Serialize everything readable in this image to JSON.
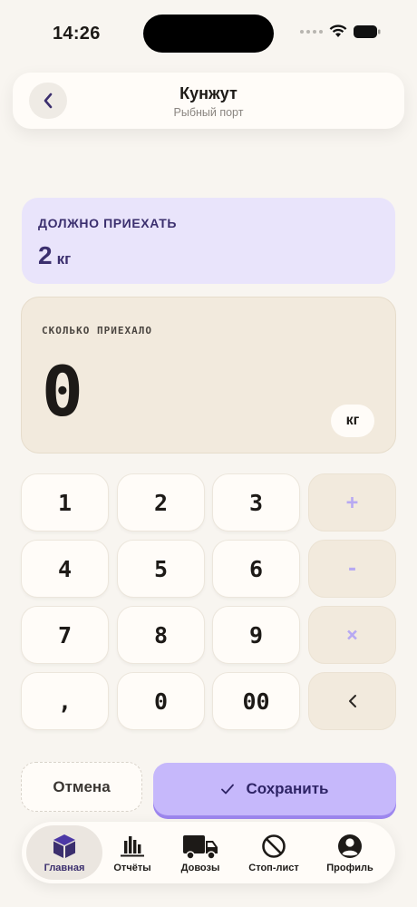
{
  "status_bar": {
    "time": "14:26"
  },
  "header": {
    "title": "Кунжут",
    "subtitle": "Рыбный порт"
  },
  "expected": {
    "label": "ДОЛЖНО ПРИЕХАТЬ",
    "value": "2",
    "unit": "кг"
  },
  "input": {
    "label": "СКОЛЬКО ПРИЕХАЛО",
    "value": "0",
    "unit": "кг"
  },
  "keypad": {
    "k1": "1",
    "k2": "2",
    "k3": "3",
    "plus": "+",
    "k4": "4",
    "k5": "5",
    "k6": "6",
    "minus": "-",
    "k7": "7",
    "k8": "8",
    "k9": "9",
    "times": "×",
    "comma": ",",
    "k0": "0",
    "k00": "00",
    "backspace": "<"
  },
  "actions": {
    "cancel": "Отмена",
    "save": "Сохранить"
  },
  "tabbar": {
    "items": [
      {
        "label": "Главная",
        "icon": "box-icon",
        "active": true
      },
      {
        "label": "Отчёты",
        "icon": "chart-icon",
        "active": false
      },
      {
        "label": "Довозы",
        "icon": "truck-icon",
        "active": false
      },
      {
        "label": "Стоп-лист",
        "icon": "prohibited-icon",
        "active": false
      },
      {
        "label": "Профиль",
        "icon": "user-icon",
        "active": false
      }
    ]
  },
  "colors": {
    "background": "#f8f5f0",
    "accent": "#c6b8fb",
    "accent_dark": "#3b2f6e",
    "expected_bg": "#e9e4fb",
    "input_bg": "#f2eadd"
  }
}
